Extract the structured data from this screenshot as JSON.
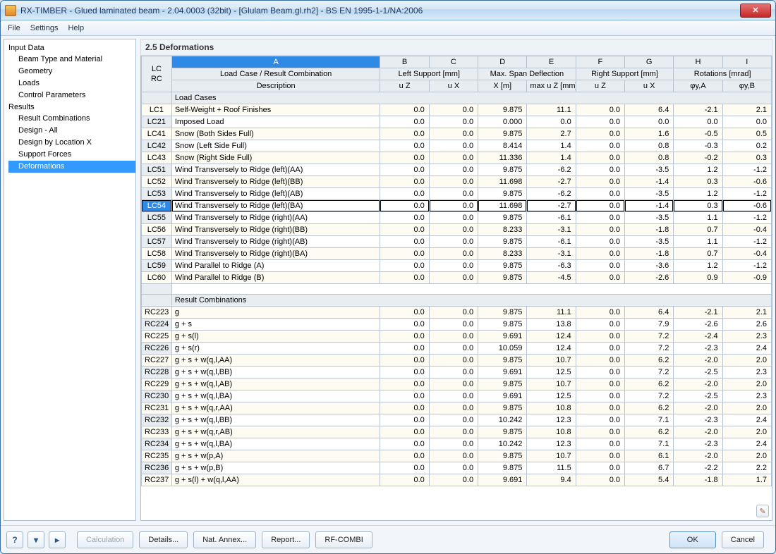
{
  "window": {
    "title": "RX-TIMBER - Glued laminated beam - 2.04.0003 (32bit) - [Glulam Beam.gl.rh2] - BS EN 1995-1-1/NA:2006"
  },
  "menu": {
    "file": "File",
    "settings": "Settings",
    "help": "Help"
  },
  "sidebar": {
    "groups": [
      {
        "label": "Input Data",
        "items": [
          "Beam Type and Material",
          "Geometry",
          "Loads",
          "Control Parameters"
        ]
      },
      {
        "label": "Results",
        "items": [
          "Result Combinations",
          "Design - All",
          "Design by Location X",
          "Support Forces",
          "Deformations"
        ],
        "selected": 4
      }
    ]
  },
  "main": {
    "title": "2.5 Deformations",
    "letters": [
      "A",
      "B",
      "C",
      "D",
      "E",
      "F",
      "G",
      "H",
      "I"
    ],
    "hdr1": [
      "Load Case / Result Combination",
      "Left Support [mm]",
      "",
      "Max. Span Deflection",
      "",
      "Right Support [mm]",
      "",
      "Rotations [mrad]",
      ""
    ],
    "hdr2": [
      "Description",
      "u Z",
      "u X",
      "X [m]",
      "max u Z [mm]",
      "u Z",
      "u X",
      "φy,A",
      "φy,B"
    ],
    "lc_label": "LC\nRC",
    "sections": {
      "load_cases": "Load Cases",
      "result_comb": "Result Combinations"
    }
  },
  "rows_lc": [
    {
      "id": "LC1",
      "desc": "Self-Weight + Roof Finishes",
      "v": [
        "0.0",
        "0.0",
        "9.875",
        "11.1",
        "0.0",
        "6.4",
        "-2.1",
        "2.1"
      ]
    },
    {
      "id": "LC21",
      "desc": "Imposed Load",
      "v": [
        "0.0",
        "0.0",
        "0.000",
        "0.0",
        "0.0",
        "0.0",
        "0.0",
        "0.0"
      ]
    },
    {
      "id": "LC41",
      "desc": "Snow (Both Sides Full)",
      "v": [
        "0.0",
        "0.0",
        "9.875",
        "2.7",
        "0.0",
        "1.6",
        "-0.5",
        "0.5"
      ]
    },
    {
      "id": "LC42",
      "desc": "Snow (Left Side Full)",
      "v": [
        "0.0",
        "0.0",
        "8.414",
        "1.4",
        "0.0",
        "0.8",
        "-0.3",
        "0.2"
      ]
    },
    {
      "id": "LC43",
      "desc": "Snow (Right Side Full)",
      "v": [
        "0.0",
        "0.0",
        "11.336",
        "1.4",
        "0.0",
        "0.8",
        "-0.2",
        "0.3"
      ]
    },
    {
      "id": "LC51",
      "desc": "Wind Transversely to Ridge (left)(AA)",
      "v": [
        "0.0",
        "0.0",
        "9.875",
        "-6.2",
        "0.0",
        "-3.5",
        "1.2",
        "-1.2"
      ]
    },
    {
      "id": "LC52",
      "desc": "Wind Transversely to Ridge (left)(BB)",
      "v": [
        "0.0",
        "0.0",
        "11.698",
        "-2.7",
        "0.0",
        "-1.4",
        "0.3",
        "-0.6"
      ]
    },
    {
      "id": "LC53",
      "desc": "Wind Transversely to Ridge (left)(AB)",
      "v": [
        "0.0",
        "0.0",
        "9.875",
        "-6.2",
        "0.0",
        "-3.5",
        "1.2",
        "-1.2"
      ]
    },
    {
      "id": "LC54",
      "desc": "Wind Transversely to Ridge (left)(BA)",
      "v": [
        "0.0",
        "0.0",
        "11.698",
        "-2.7",
        "0.0",
        "-1.4",
        "0.3",
        "-0.6"
      ],
      "sel": true
    },
    {
      "id": "LC55",
      "desc": "Wind Transversely to Ridge (right)(AA)",
      "v": [
        "0.0",
        "0.0",
        "9.875",
        "-6.1",
        "0.0",
        "-3.5",
        "1.1",
        "-1.2"
      ]
    },
    {
      "id": "LC56",
      "desc": "Wind Transversely to Ridge (right)(BB)",
      "v": [
        "0.0",
        "0.0",
        "8.233",
        "-3.1",
        "0.0",
        "-1.8",
        "0.7",
        "-0.4"
      ]
    },
    {
      "id": "LC57",
      "desc": "Wind Transversely to Ridge (right)(AB)",
      "v": [
        "0.0",
        "0.0",
        "9.875",
        "-6.1",
        "0.0",
        "-3.5",
        "1.1",
        "-1.2"
      ]
    },
    {
      "id": "LC58",
      "desc": "Wind Transversely to Ridge (right)(BA)",
      "v": [
        "0.0",
        "0.0",
        "8.233",
        "-3.1",
        "0.0",
        "-1.8",
        "0.7",
        "-0.4"
      ]
    },
    {
      "id": "LC59",
      "desc": "Wind Parallel to Ridge (A)",
      "v": [
        "0.0",
        "0.0",
        "9.875",
        "-6.3",
        "0.0",
        "-3.6",
        "1.2",
        "-1.2"
      ]
    },
    {
      "id": "LC60",
      "desc": "Wind Parallel to Ridge (B)",
      "v": [
        "0.0",
        "0.0",
        "9.875",
        "-4.5",
        "0.0",
        "-2.6",
        "0.9",
        "-0.9"
      ]
    }
  ],
  "rows_rc": [
    {
      "id": "RC223",
      "desc": "g",
      "v": [
        "0.0",
        "0.0",
        "9.875",
        "11.1",
        "0.0",
        "6.4",
        "-2.1",
        "2.1"
      ]
    },
    {
      "id": "RC224",
      "desc": "g + s",
      "v": [
        "0.0",
        "0.0",
        "9.875",
        "13.8",
        "0.0",
        "7.9",
        "-2.6",
        "2.6"
      ]
    },
    {
      "id": "RC225",
      "desc": "g + s(l)",
      "v": [
        "0.0",
        "0.0",
        "9.691",
        "12.4",
        "0.0",
        "7.2",
        "-2.4",
        "2.3"
      ]
    },
    {
      "id": "RC226",
      "desc": "g + s(r)",
      "v": [
        "0.0",
        "0.0",
        "10.059",
        "12.4",
        "0.0",
        "7.2",
        "-2.3",
        "2.4"
      ]
    },
    {
      "id": "RC227",
      "desc": "g + s + w(q,l,AA)",
      "v": [
        "0.0",
        "0.0",
        "9.875",
        "10.7",
        "0.0",
        "6.2",
        "-2.0",
        "2.0"
      ]
    },
    {
      "id": "RC228",
      "desc": "g + s + w(q,l,BB)",
      "v": [
        "0.0",
        "0.0",
        "9.691",
        "12.5",
        "0.0",
        "7.2",
        "-2.5",
        "2.3"
      ]
    },
    {
      "id": "RC229",
      "desc": "g + s + w(q,l,AB)",
      "v": [
        "0.0",
        "0.0",
        "9.875",
        "10.7",
        "0.0",
        "6.2",
        "-2.0",
        "2.0"
      ]
    },
    {
      "id": "RC230",
      "desc": "g + s + w(q,l,BA)",
      "v": [
        "0.0",
        "0.0",
        "9.691",
        "12.5",
        "0.0",
        "7.2",
        "-2.5",
        "2.3"
      ]
    },
    {
      "id": "RC231",
      "desc": "g + s + w(q,r,AA)",
      "v": [
        "0.0",
        "0.0",
        "9.875",
        "10.8",
        "0.0",
        "6.2",
        "-2.0",
        "2.0"
      ]
    },
    {
      "id": "RC232",
      "desc": "g + s + w(q,l,BB)",
      "v": [
        "0.0",
        "0.0",
        "10.242",
        "12.3",
        "0.0",
        "7.1",
        "-2.3",
        "2.4"
      ]
    },
    {
      "id": "RC233",
      "desc": "g + s + w(q,r,AB)",
      "v": [
        "0.0",
        "0.0",
        "9.875",
        "10.8",
        "0.0",
        "6.2",
        "-2.0",
        "2.0"
      ]
    },
    {
      "id": "RC234",
      "desc": "g + s + w(q,l,BA)",
      "v": [
        "0.0",
        "0.0",
        "10.242",
        "12.3",
        "0.0",
        "7.1",
        "-2.3",
        "2.4"
      ]
    },
    {
      "id": "RC235",
      "desc": "g + s + w(p,A)",
      "v": [
        "0.0",
        "0.0",
        "9.875",
        "10.7",
        "0.0",
        "6.1",
        "-2.0",
        "2.0"
      ]
    },
    {
      "id": "RC236",
      "desc": "g + s + w(p,B)",
      "v": [
        "0.0",
        "0.0",
        "9.875",
        "11.5",
        "0.0",
        "6.7",
        "-2.2",
        "2.2"
      ]
    },
    {
      "id": "RC237",
      "desc": "g + s(l) + w(q,l,AA)",
      "v": [
        "0.0",
        "0.0",
        "9.691",
        "9.4",
        "0.0",
        "5.4",
        "-1.8",
        "1.7"
      ]
    }
  ],
  "footer": {
    "calculation": "Calculation",
    "details": "Details...",
    "nat": "Nat. Annex...",
    "report": "Report...",
    "combi": "RF-COMBI",
    "ok": "OK",
    "cancel": "Cancel"
  }
}
